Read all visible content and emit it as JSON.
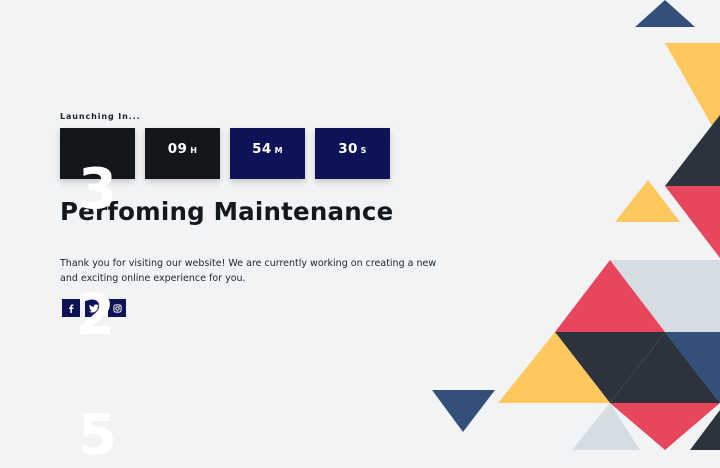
{
  "launching_label": "Launching In...",
  "countdown": [
    {
      "value": "",
      "unit": ""
    },
    {
      "value": "09",
      "unit": "H"
    },
    {
      "value": "54",
      "unit": "M"
    },
    {
      "value": "30",
      "unit": "S"
    }
  ],
  "ghost_digits": [
    "3",
    "2",
    "5"
  ],
  "title": "Perfoming Maintenance",
  "message": "Thank you for visiting our website! We are currently working on creating a new and exciting online experience for you.",
  "social": [
    {
      "name": "facebook",
      "icon": "facebook-icon"
    },
    {
      "name": "twitter",
      "icon": "twitter-icon"
    },
    {
      "name": "instagram",
      "icon": "instagram-icon"
    }
  ],
  "colors": {
    "background": "#f2f3f5",
    "navy": "#0e1357",
    "dark_box": "#13171c",
    "coral": "#e8465d",
    "yellow": "#fec85e",
    "slate_blue": "#33507a",
    "charcoal": "#2d333c",
    "pale_gray": "#d5dde3"
  }
}
